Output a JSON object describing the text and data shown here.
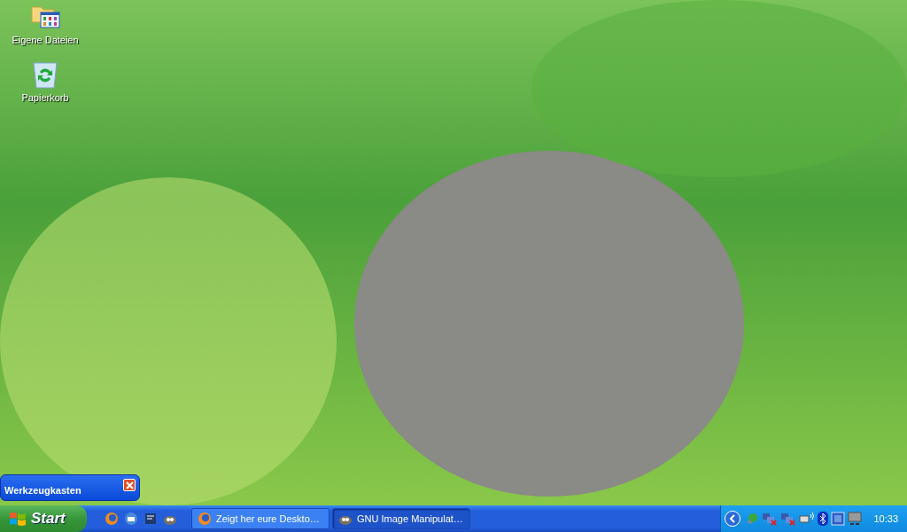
{
  "desktop_icons": [
    {
      "kind": "folder",
      "label": "Eigene Dateien"
    },
    {
      "kind": "recycle",
      "label": "Papierkorb"
    }
  ],
  "toolbar_window": {
    "title": "Werkzeugkasten"
  },
  "taskbar": {
    "start_label": "Start",
    "tasks": [
      {
        "kind": "browser",
        "label": "Zeigt her eure Deskto…",
        "selected": false
      },
      {
        "kind": "gimp",
        "label": "GNU Image Manipulat…",
        "selected": true
      }
    ],
    "clock": "10:33"
  }
}
